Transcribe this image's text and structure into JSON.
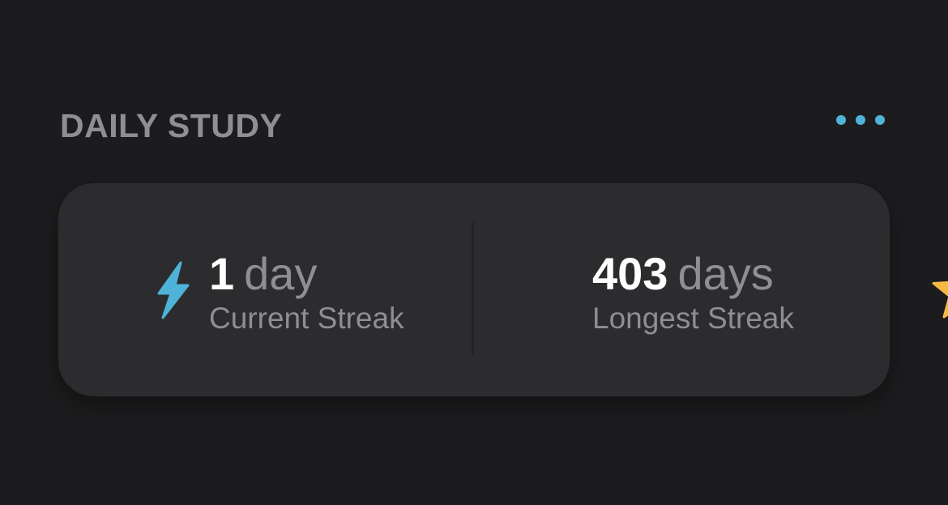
{
  "section": {
    "title": "DAILY STUDY",
    "more_icon": "ellipsis-icon"
  },
  "colors": {
    "background": "#1c1c1e",
    "card": "#2c2c2e",
    "accent": "#4fb3d9",
    "star": "#f5b942",
    "secondary_text": "#8e8e93",
    "primary_text": "#ffffff"
  },
  "stats": {
    "current": {
      "icon": "lightning-bolt-icon",
      "value": "1",
      "unit": "day",
      "label": "Current Streak"
    },
    "longest": {
      "icon": "star-icon",
      "value": "403",
      "unit": "days",
      "label": "Longest Streak"
    }
  }
}
